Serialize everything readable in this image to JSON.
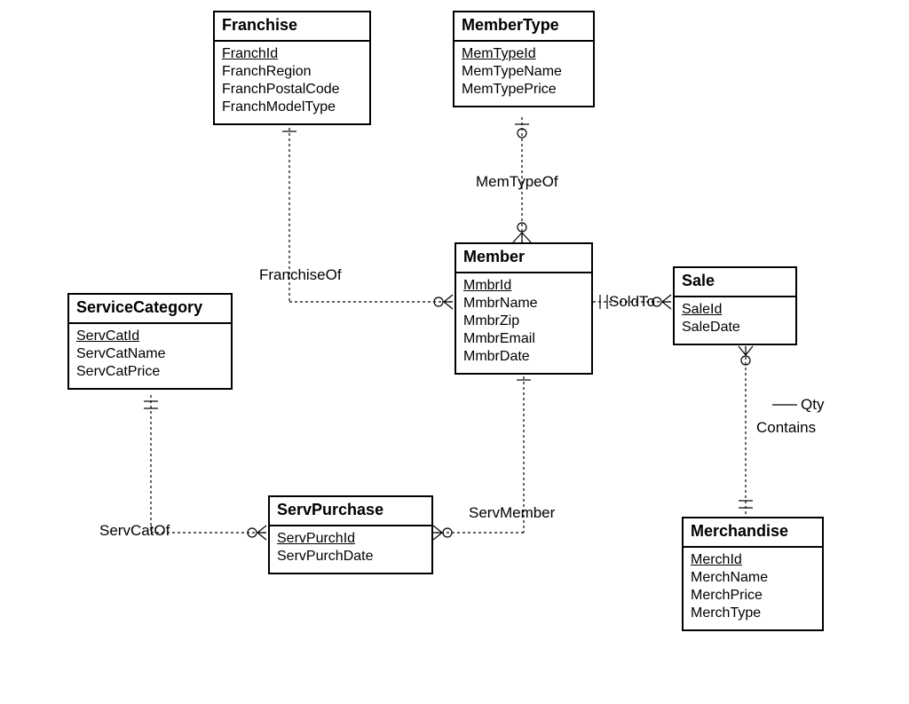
{
  "entities": {
    "franchise": {
      "title": "Franchise",
      "pk": "FranchId",
      "attrs": [
        "FranchRegion",
        "FranchPostalCode",
        "FranchModelType"
      ]
    },
    "memberType": {
      "title": "MemberType",
      "pk": "MemTypeId",
      "attrs": [
        "MemTypeName",
        "MemTypePrice"
      ]
    },
    "member": {
      "title": "Member",
      "pk": "MmbrId",
      "attrs": [
        "MmbrName",
        "MmbrZip",
        "MmbrEmail",
        "MmbrDate"
      ]
    },
    "sale": {
      "title": "Sale",
      "pk": "SaleId",
      "attrs": [
        "SaleDate"
      ]
    },
    "serviceCategory": {
      "title": "ServiceCategory",
      "pk": "ServCatId",
      "attrs": [
        "ServCatName",
        "ServCatPrice"
      ]
    },
    "servPurchase": {
      "title": "ServPurchase",
      "pk": "ServPurchId",
      "attrs": [
        "ServPurchDate"
      ]
    },
    "merchandise": {
      "title": "Merchandise",
      "pk": "MerchId",
      "attrs": [
        "MerchName",
        "MerchPrice",
        "MerchType"
      ]
    }
  },
  "relationships": {
    "memTypeOf": "MemTypeOf",
    "franchiseOf": "FranchiseOf",
    "soldTo": "SoldTo",
    "contains": "Contains",
    "containsAttr": "Qty",
    "servMember": "ServMember",
    "servCatOf": "ServCatOf"
  }
}
